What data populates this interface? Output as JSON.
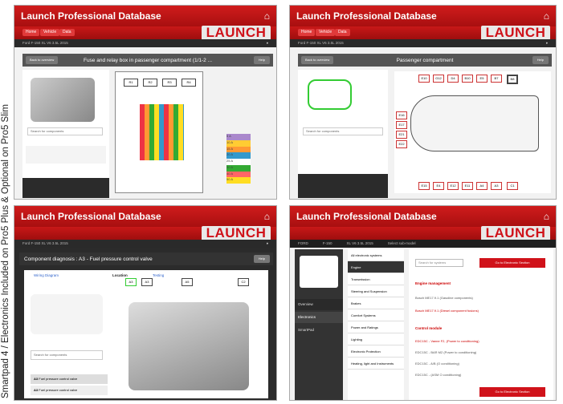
{
  "side_caption": "Smartpad 4 / Electronics Included on Pro5 Plus & Optional on Pro5 Slim",
  "brand": "LAUNCH",
  "panels": [
    {
      "title": "Launch Professional Database",
      "crumb": "Ford F-150 XL V6 3.5L 2015",
      "heading": "Fuse and relay box in passenger compartment (1/1-2 ...",
      "back": "Back to overview",
      "btn": "Help",
      "search": "Search for components",
      "fuse_values": [
        "5 A",
        "10 A",
        "15 A",
        "20 A",
        "25 A",
        "30 A",
        "40 A",
        "50 A"
      ]
    },
    {
      "title": "Launch Professional Database",
      "crumb": "Ford F-150 XL V6 3.5L 2015",
      "heading": "Passenger compartment",
      "back": "Back to overview",
      "btn": "Help",
      "search": "Search for components",
      "labels": [
        "E10",
        "G12",
        "D4",
        "B10",
        "E5",
        "B7",
        "B8",
        "E15",
        "E4",
        "E12",
        "E11",
        "A4",
        "A3",
        "C1",
        "E16",
        "E17",
        "E21",
        "E22"
      ]
    },
    {
      "title": "Launch Professional Database",
      "crumb": "Ford F-150 XL V6 3.5L 2015",
      "heading": "Component diagnosis : A3 - Fuel pressure control valve",
      "btn": "Help",
      "tabs": [
        "Wiring Diagram",
        "Location",
        "Testing"
      ],
      "search": "Search for components",
      "rows": [
        {
          "id": "A3",
          "text": "Fuel pressure control valve"
        },
        {
          "id": "A3",
          "text": "Fuel pressure control valve"
        }
      ],
      "callouts": [
        "A3",
        "A3",
        "A5",
        "C2"
      ]
    },
    {
      "title": "Launch Professional Database",
      "crumb_items": [
        "FORD",
        "F-150",
        "XL V6 3.5L 2015",
        "Select sub-model"
      ],
      "nav": [
        "Overview",
        "Electronics",
        "SmartPad"
      ],
      "menu": [
        "All electronic systems",
        "Engine",
        "Transmission",
        "Steering and Suspension",
        "Brakes",
        "Comfort Systems",
        "Power and Ratings",
        "Lighting",
        "Electronic Protection",
        "Heating, light and Instruments"
      ],
      "search_placeholder": "Search for systems",
      "red_btn": "Go to Electronic Section",
      "sections": [
        {
          "title": "Engine management",
          "items": [
            "Bosch ME17.9.1 (Gasoline components)",
            "Bosch ME17.9.1 (Diesel component fusions)"
          ]
        },
        {
          "title": "Control module",
          "items": [
            "EDC15C - Vanne F2, (Power to conditioning)",
            "EDC15C - BAR M2 (Power to conditioning)",
            "EDC15C - A/B (O conditioning)",
            "EDC15C - (ASM O conditioning)"
          ]
        }
      ],
      "bottom_btn": "Go to Electronic Section"
    }
  ]
}
